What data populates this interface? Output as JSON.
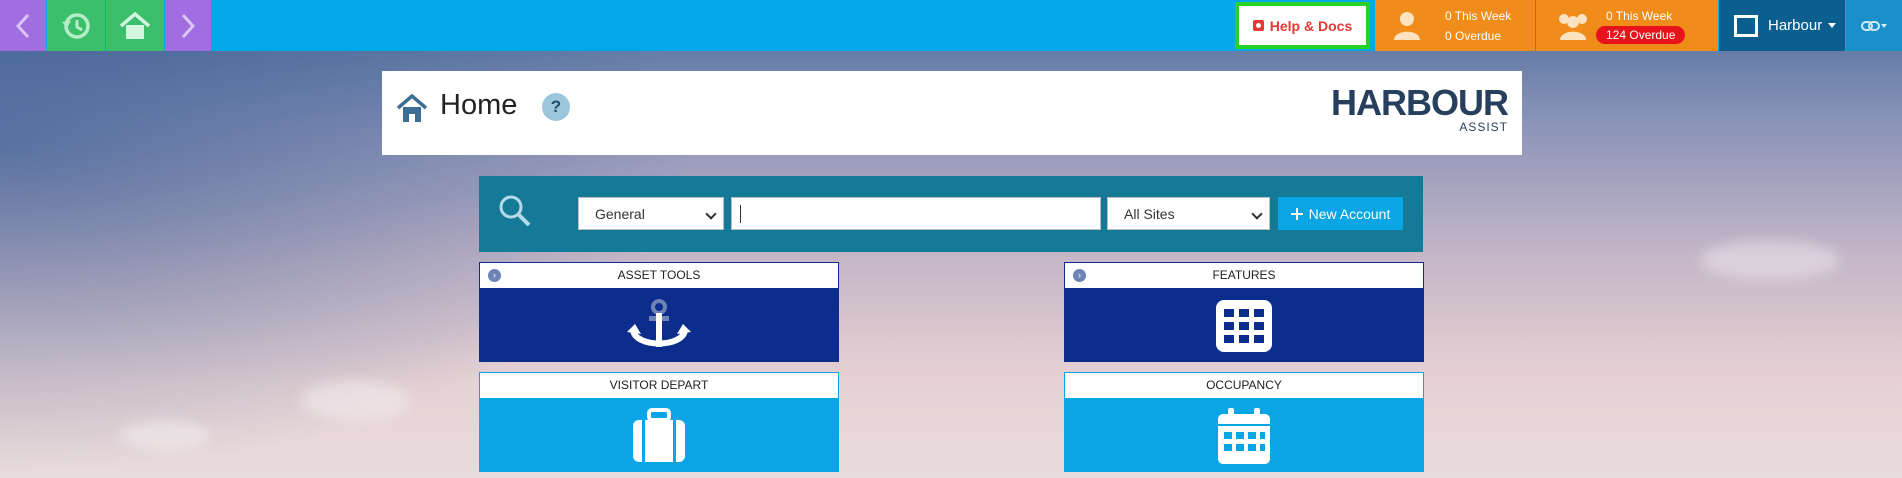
{
  "topbar": {
    "help_label": "Help & Docs",
    "my_tasks": {
      "this_week": "0 This Week",
      "overdue": "0 Overdue"
    },
    "team_tasks": {
      "this_week": "0 This Week",
      "overdue": "124 Overdue"
    },
    "account_name": "Harbour"
  },
  "header": {
    "title": "Home",
    "help_symbol": "?",
    "brand_main": "HARBOUR",
    "brand_sub": "ASSIST"
  },
  "search": {
    "category_value": "General",
    "query_value": "",
    "site_value": "All Sites",
    "new_account_label": "New Account"
  },
  "tiles": [
    {
      "label": "ASSET TOOLS",
      "icon": "anchor-icon",
      "expandable": true
    },
    {
      "label": "FEATURES",
      "icon": "grid-icon",
      "expandable": true
    },
    {
      "label": "VISITOR DEPART",
      "icon": "suitcase-icon",
      "expandable": false
    },
    {
      "label": "OCCUPANCY",
      "icon": "calendar-icon",
      "expandable": false
    }
  ],
  "colors": {
    "topbar": "#03a9e6",
    "nav_purple": "#a06ee0",
    "nav_green": "#3cbf6b",
    "tasks_orange": "#ef8c1a",
    "overdue_red": "#e8131b",
    "tile_dark": "#0d2d8c",
    "tile_light": "#0aa5e4",
    "search_bar": "#147a98"
  }
}
